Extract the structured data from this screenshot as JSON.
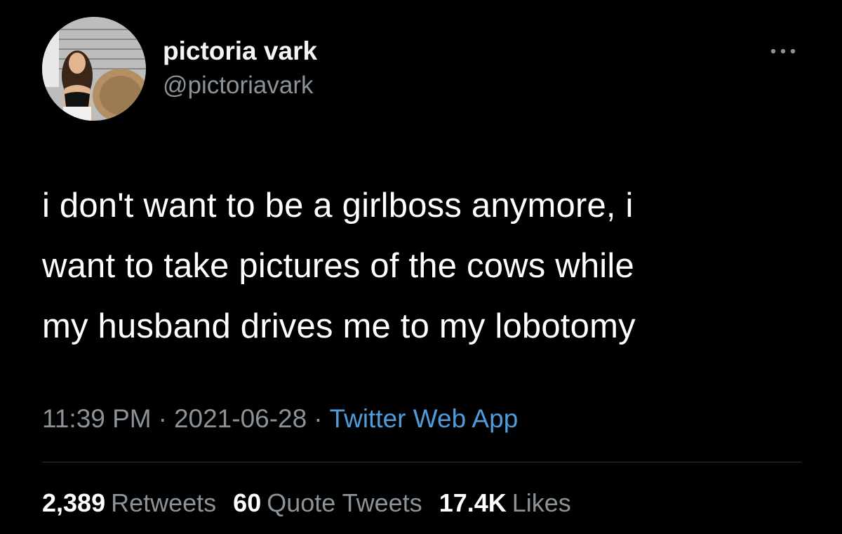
{
  "author": {
    "display_name": "pictoria vark",
    "handle": "@pictoriavark",
    "avatar": "profile-photo"
  },
  "tweet": {
    "lines": [
      "i don't want to be a girlboss anymore, i",
      "want to take pictures of the cows while",
      "my husband drives me to my lobotomy"
    ]
  },
  "meta": {
    "time": "11:39 PM",
    "separator": "·",
    "date": "2021-06-28",
    "source": "Twitter Web App"
  },
  "stats": {
    "retweets_count": "2,389",
    "retweets_label": "Retweets",
    "quotes_count": "60",
    "quotes_label": "Quote Tweets",
    "likes_count": "17.4K",
    "likes_label": "Likes"
  },
  "colors": {
    "background": "#000000",
    "text": "#ffffff",
    "secondary": "#8b9399",
    "link": "#4f9bdc",
    "divider": "#2f3336"
  },
  "icons": {
    "more": "more-horizontal-icon"
  }
}
